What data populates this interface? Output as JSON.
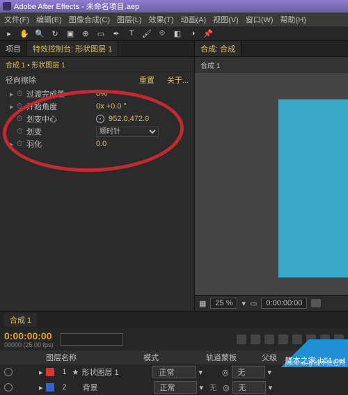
{
  "app": {
    "title": "Adobe After Effects - 未命名项目.aep"
  },
  "menus": [
    "文件(F)",
    "编辑(E)",
    "图像合成(C)",
    "图层(L)",
    "效果(T)",
    "动画(A)",
    "视图(V)",
    "窗口(W)",
    "帮助(H)"
  ],
  "left": {
    "tabs": [
      "项目",
      "特效控制台: 形状图层 1"
    ],
    "breadcrumb": "合成 1 • 形状图层 1",
    "effect": {
      "name": "径向擦除",
      "reset": "重置",
      "about": "关于...",
      "props": [
        {
          "label": "过渡完成量",
          "val": "0%",
          "twirl": true
        },
        {
          "label": "开始角度",
          "val": "0x +0.0 °",
          "twirl": true
        },
        {
          "label": "划变中心",
          "val": "952.0,472.0",
          "target": true
        },
        {
          "label": "划变",
          "val": "顺时针",
          "dropdown": true
        },
        {
          "label": "羽化",
          "val": "0.0",
          "twirl": true
        }
      ]
    }
  },
  "right": {
    "tab": "合成: 合成",
    "breadcrumb": "合成 1",
    "footer": {
      "zoom": "25 %",
      "timecode": "0:00:00:00"
    }
  },
  "timeline": {
    "tab": "合成 1",
    "timecode": "0:00:00:00",
    "fps": "00000 (25.00 fps)",
    "search_placeholder": "",
    "columns": {
      "c2": "图层名称",
      "c3": "模式",
      "c4": "轨道蒙板",
      "c5": "父级"
    },
    "layers": [
      {
        "num": "1",
        "name": "形状图层 1",
        "mode": "正常",
        "track": "",
        "parent": "无",
        "color": "#d33"
      },
      {
        "num": "2",
        "name": "背景",
        "mode": "正常",
        "track": "无",
        "parent": "无",
        "color": "#36c"
      }
    ]
  },
  "watermark": {
    "line1": "脚本之家 jb51.net",
    "line2": "jiaocheng.刷本教程网"
  }
}
